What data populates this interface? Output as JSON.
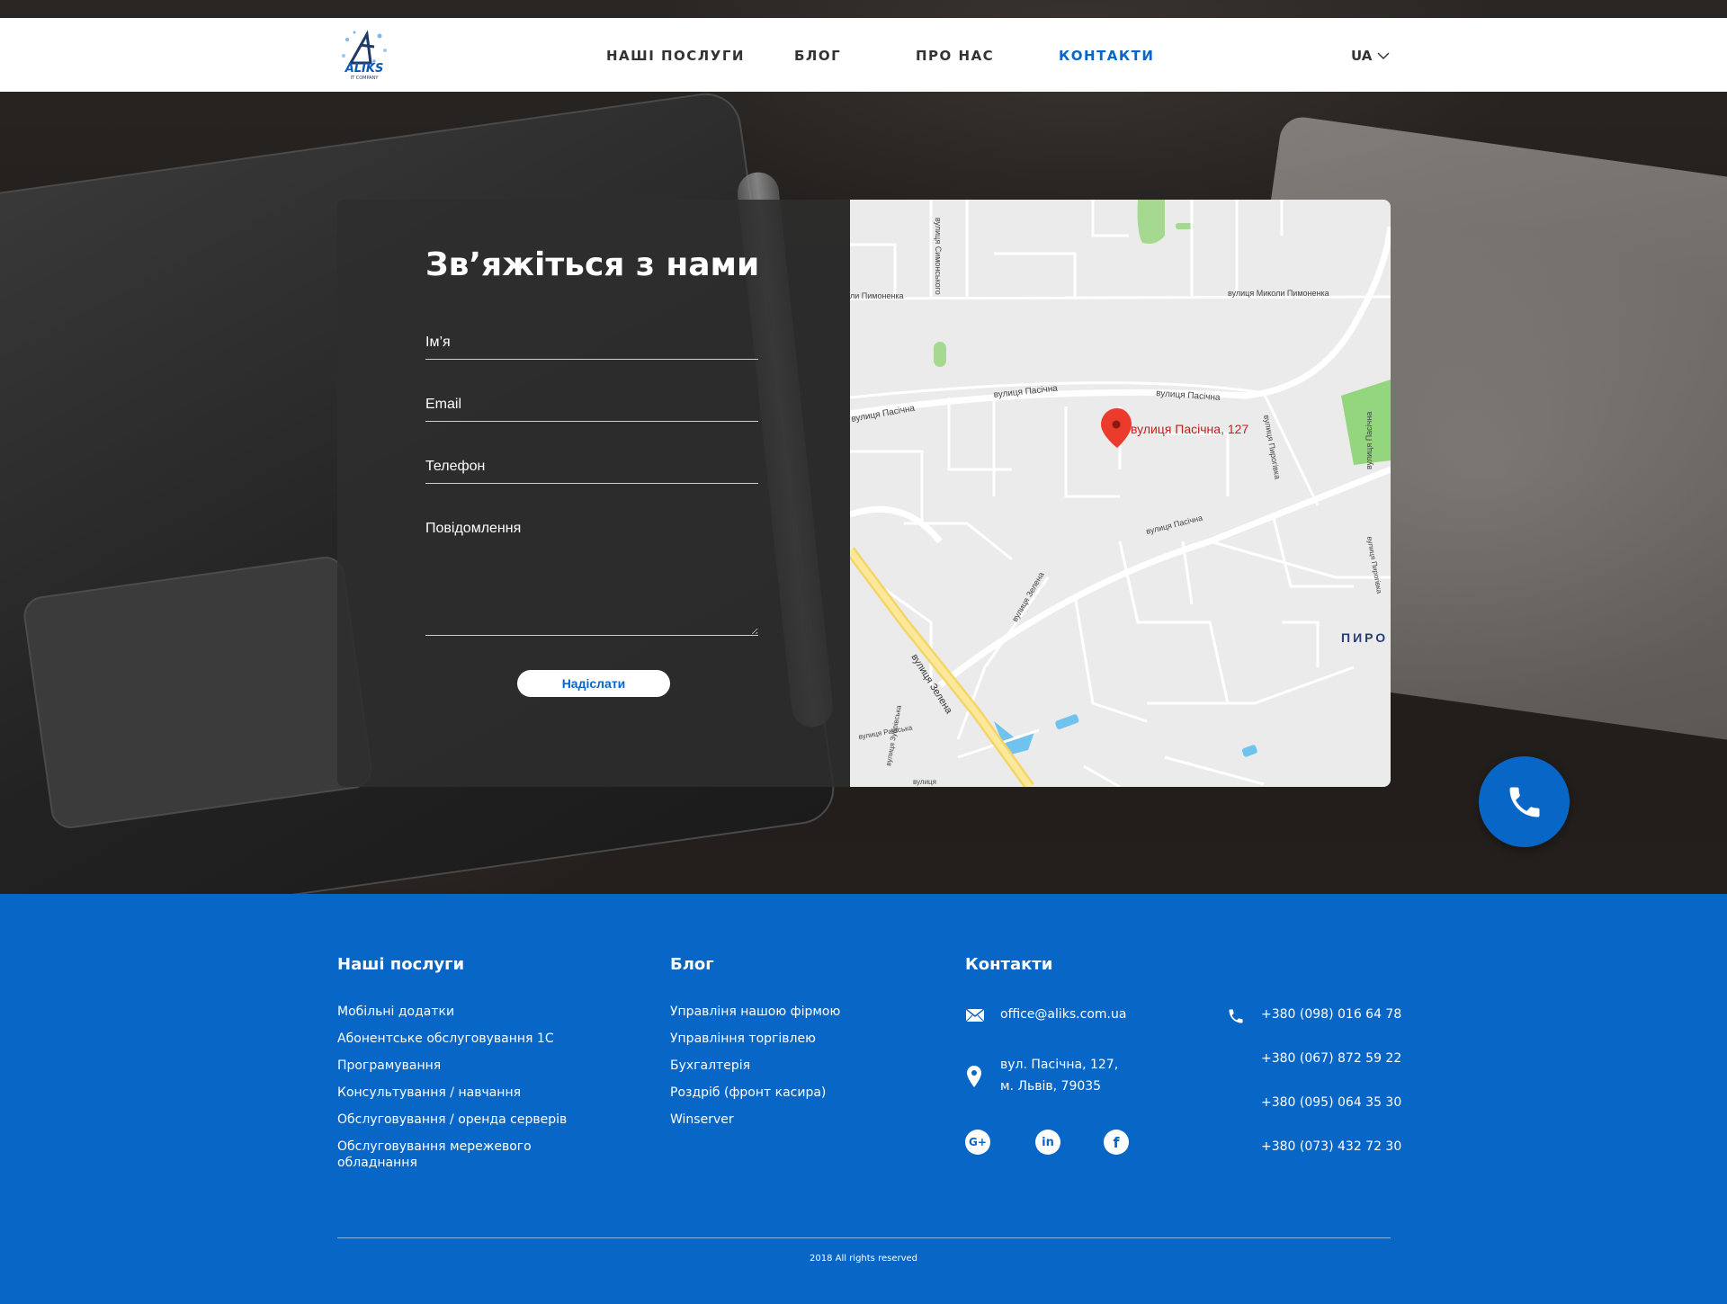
{
  "header": {
    "logo_text": "ALIKS",
    "logo_subtext": "IT COMPANY",
    "nav": [
      {
        "label": "НАШІ ПОСЛУГИ"
      },
      {
        "label": "БЛОГ"
      },
      {
        "label": "ПРО НАС"
      },
      {
        "label": "КОНТАКТИ"
      }
    ],
    "language": "UA"
  },
  "contact_form": {
    "title": "Зв’яжіться з нами",
    "fields": {
      "name_label": "Ім’я",
      "email_label": "Email",
      "phone_label": "Телефон",
      "message_label": "Повідомлення"
    },
    "submit_label": "Надіслати"
  },
  "map": {
    "marker_label": "вулиця Пасічна, 127",
    "street_labels": {
      "pymonenka_left": "ли Пимоненка",
      "mykoly_pymonenka": "вулиця Миколи Пимоненка",
      "pasichna_1": "вулиця Пасічна",
      "pasichna_2": "вулиця Пасічна",
      "pasichna_3": "вулиця Пасічна",
      "pasichna_4": "вулиця Пасічна",
      "pasichna_right": "вулиця Пасічна",
      "zelena_1": "вулиця Зелена",
      "zelena_2": "вулиця Зелена",
      "symonenka": "вулиця Симонського",
      "pyrohivka": "вулиця Пирогівка",
      "pyrohivka_right": "вулиця Пирогівка",
      "zubrivska": "вулиця Зубрівська",
      "raivska": "вулиця Раївська",
      "zelena_bottom": "вулиця",
      "district": "ПИРО"
    }
  },
  "footer": {
    "services": {
      "heading": "Наші послуги",
      "items": [
        "Мобільні додатки",
        "Абонентське обслуговування 1С",
        "Програмування",
        "Консультування / навчання",
        "Обслуговування / оренда серверів",
        "Обслуговування мережевого обладнання"
      ]
    },
    "blog": {
      "heading": "Блог",
      "items": [
        "Управлiня нашою фірмою",
        "Управління торгівлею",
        "Бухгалтерія",
        "Роздріб (фронт касира)",
        "Winserver"
      ]
    },
    "contacts": {
      "heading": "Контакти",
      "email": "office@aliks.com.ua",
      "address_line1": "вул. Пасічна, 127,",
      "address_line2": "м. Львів, 79035",
      "phones": [
        "+380 (098) 016 64 78",
        "+380 (067) 872 59 22",
        "+380 (095) 064 35 30",
        "+380 (073) 432 72 30"
      ]
    },
    "copyright": "2018 All rights reserved"
  },
  "colors": {
    "brand_blue": "#0866c6",
    "white": "#ffffff",
    "map_bg": "#ebebeb"
  },
  "icons": {
    "call": "phone-icon",
    "email": "envelope-icon",
    "address": "map-pin-icon",
    "phone": "phone-icon",
    "social": [
      "google-plus-icon",
      "linkedin-icon",
      "facebook-icon"
    ]
  }
}
